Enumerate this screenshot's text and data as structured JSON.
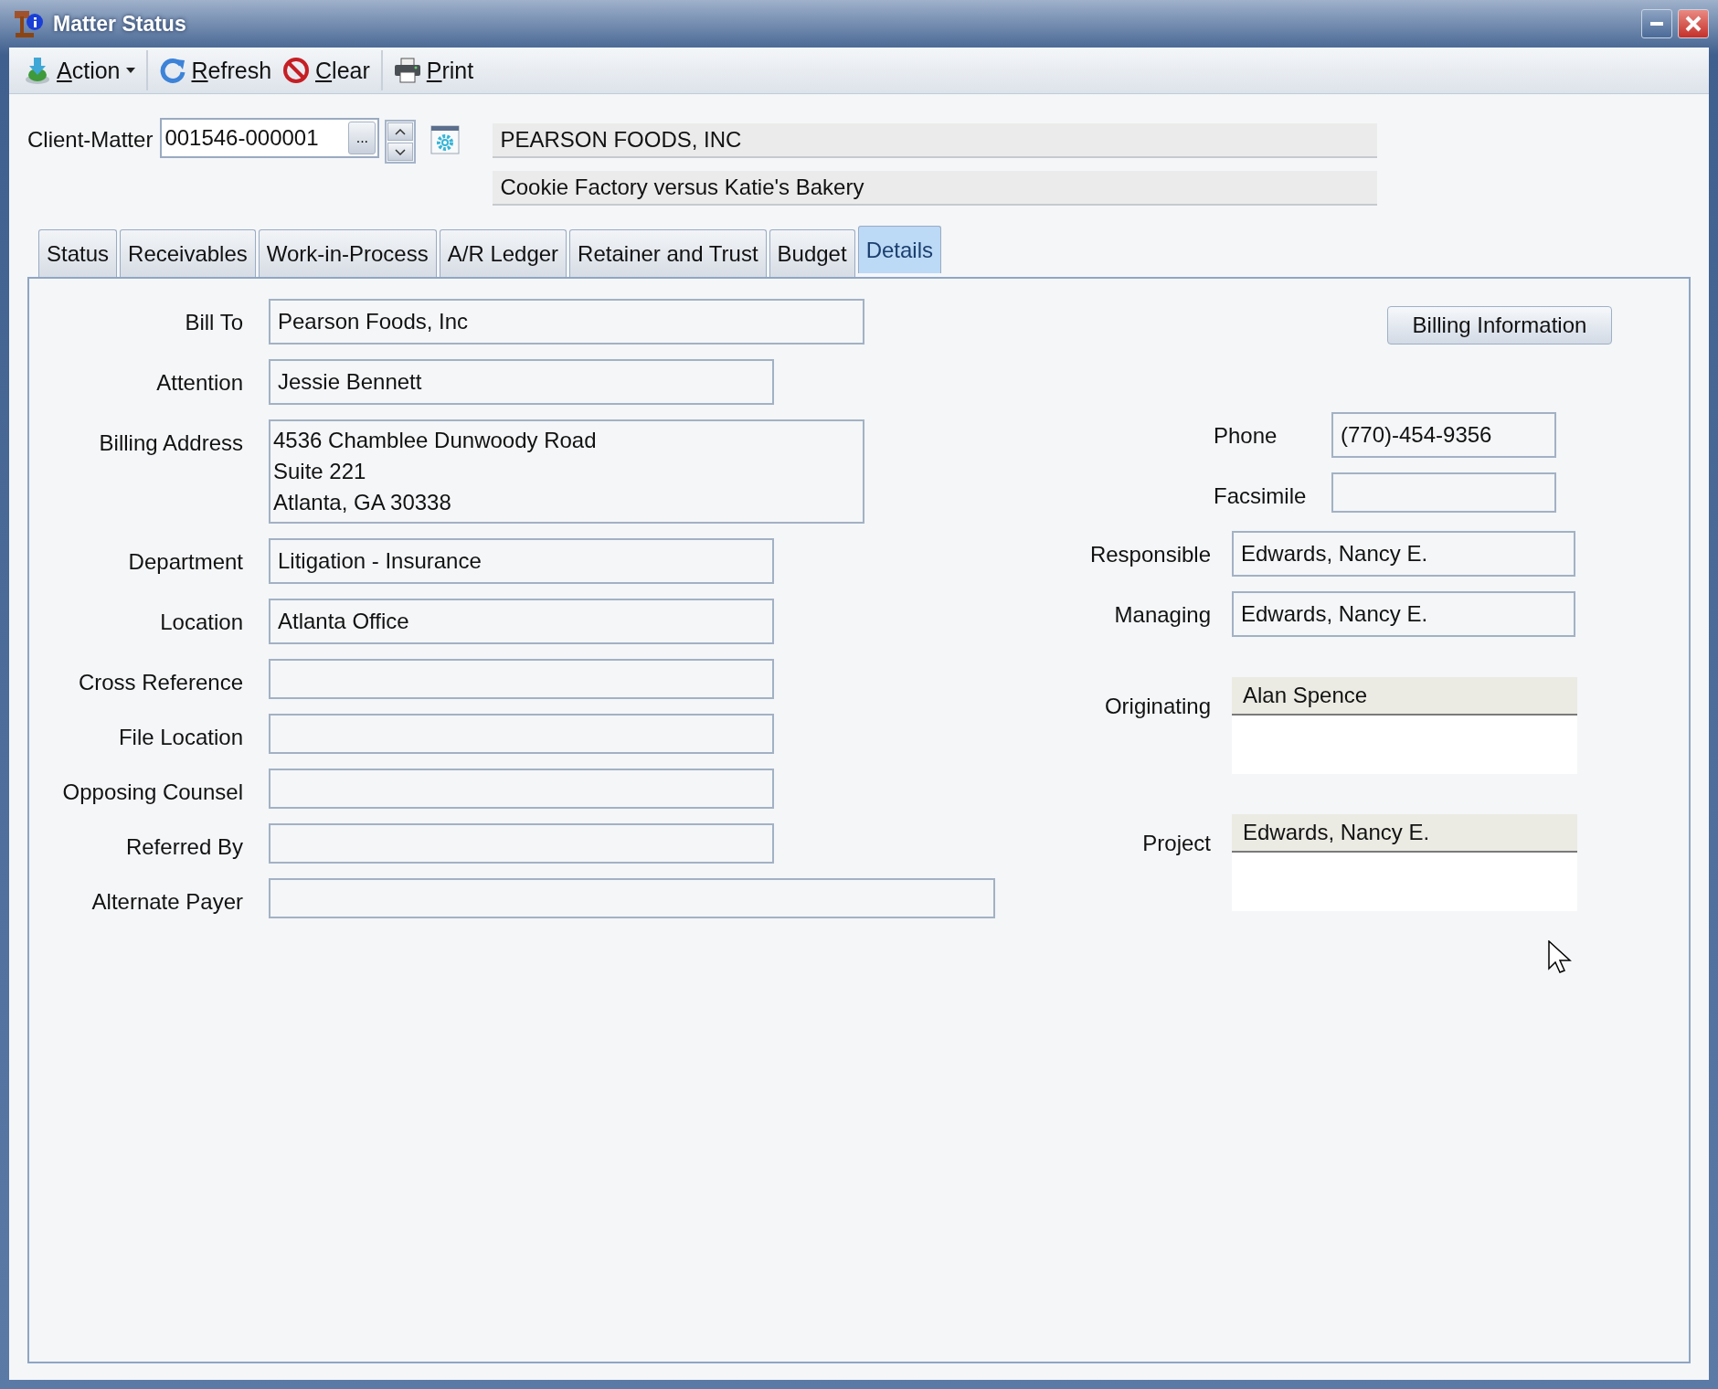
{
  "window": {
    "title": "Matter Status"
  },
  "toolbar": [
    {
      "items": [
        {
          "label": "Action",
          "kind": "menu"
        }
      ]
    },
    {
      "items": [
        {
          "label": "Refresh",
          "kind": "refresh"
        },
        {
          "label": "Clear",
          "kind": "clear"
        }
      ]
    },
    {
      "items": [
        {
          "label": "Print",
          "kind": "print"
        }
      ]
    }
  ],
  "client_matter": {
    "label": "Client-Matter",
    "value": "001546-000001",
    "browse": "..."
  },
  "client_name": "PEARSON FOODS, INC",
  "matter_name": "Cookie Factory versus Katie's Bakery",
  "tabs": [
    {
      "label": "Status",
      "selected": false
    },
    {
      "label": "Receivables",
      "selected": false
    },
    {
      "label": "Work-in-Process",
      "selected": false
    },
    {
      "label": "A/R Ledger",
      "selected": false
    },
    {
      "label": "Retainer and Trust",
      "selected": false
    },
    {
      "label": "Budget",
      "selected": false
    },
    {
      "label": "Details",
      "selected": true
    }
  ],
  "fields": [
    {
      "label": "Bill To",
      "kind": "text",
      "value": "Pearson Foods, Inc"
    },
    {
      "label": "Attention",
      "kind": "text",
      "value": "Jessie Bennett"
    },
    {
      "label": "Billing Address",
      "kind": "address",
      "lines": [
        "4536 Chamblee Dunwoody Road",
        "Suite 221",
        "Atlanta, GA 30338"
      ]
    },
    {
      "label": "Department",
      "kind": "text",
      "value": "Litigation - Insurance"
    },
    {
      "label": "Location",
      "kind": "text",
      "value": "Atlanta Office"
    },
    {
      "label": "Cross Reference",
      "kind": "text"
    },
    {
      "label": "File Location",
      "kind": "text"
    },
    {
      "label": "Opposing Counsel",
      "kind": "text"
    },
    {
      "label": "Referred By",
      "kind": "text"
    },
    {
      "label": "Alternate Payer",
      "kind": "text"
    }
  ],
  "billing_button": "Billing Information",
  "contact": [
    {
      "label": "Phone",
      "value": "(770)-454-9356"
    },
    {
      "label": "Facsimile"
    }
  ],
  "staff": [
    {
      "label": "Responsible",
      "value": "Edwards, Nancy E."
    },
    {
      "label": "Managing",
      "value": "Edwards, Nancy E."
    }
  ],
  "lookups": [
    {
      "label": "Originating",
      "value": "Alan Spence"
    },
    {
      "label": "Project",
      "value": "Edwards, Nancy E."
    }
  ]
}
